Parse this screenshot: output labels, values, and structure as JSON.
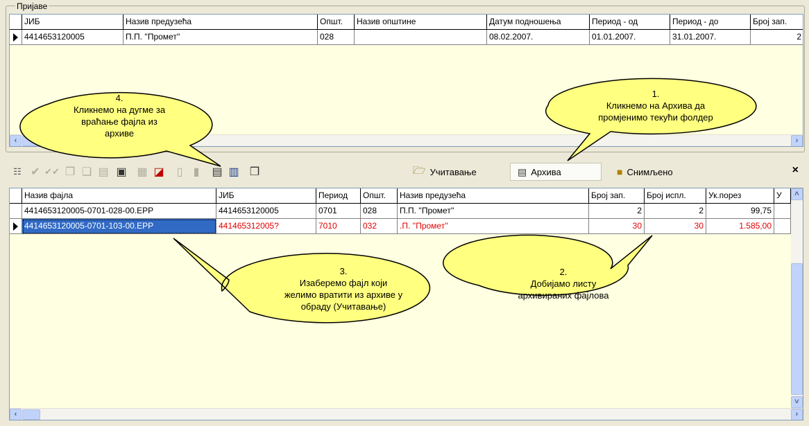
{
  "group": {
    "title": "Пријаве"
  },
  "top_table": {
    "columns": [
      "ЈИБ",
      "Назив предузећа",
      "Општ.",
      "Назив општине",
      "Датум подношења",
      "Период - од",
      "Период - до",
      "Број зап."
    ],
    "rows": [
      [
        "4414653120005",
        "П.П. ''Промет''",
        "028",
        "",
        "08.02.2007.",
        "01.01.2007.",
        "31.01.2007.",
        "2"
      ]
    ]
  },
  "toolbar": {
    "icons": [
      "columns-icon",
      "check-icon",
      "double-check-icon",
      "add-doc-icon",
      "copy-doc-icon",
      "move-doc-icon",
      "inspect-icon",
      "doc-arrow-icon",
      "restore-file-icon",
      "page-icon",
      "pages-icon",
      "report-icon",
      "report-table-icon",
      "stack-icon"
    ],
    "load_label": "Учитавање",
    "archive_label": "Архива",
    "saved_label": "Снимљено",
    "close": "×"
  },
  "bottom_table": {
    "columns": [
      "Назив фајла",
      "ЈИБ",
      "Период",
      "Општ.",
      "Назив предузећа",
      "Број зап.",
      "Број испл.",
      "Ук.порез",
      "У"
    ],
    "rows": [
      [
        "4414653120005-0701-028-00.EPP",
        "4414653120005",
        "0701",
        "028",
        "П.П. ''Промет''",
        "2",
        "2",
        "99,75"
      ],
      [
        "4414653120005-0701-103-00.EPP",
        "441465312005?",
        "7010",
        "032",
        ".П. ''Промет''",
        "30",
        "30",
        "1.585,00"
      ]
    ]
  },
  "callouts": {
    "c1": [
      "1.",
      "Кликнемо на Архива да",
      "промјенимо текући фолдер"
    ],
    "c2": [
      "2.",
      "Добијамо листу",
      "архивираних фајлова"
    ],
    "c3": [
      "3.",
      "Изаберемо фајл који",
      "желимо вратити из архиве у",
      "обраду (Учитавање)"
    ],
    "c4": [
      "4.",
      "Кликнемо на дугме за",
      "враћање фајла из",
      "архиве"
    ]
  },
  "colors": {
    "bubble": "#ffff80",
    "selection": "#316ac5",
    "invalid_row": "#e00000",
    "grid_bg": "#ffffe1"
  }
}
